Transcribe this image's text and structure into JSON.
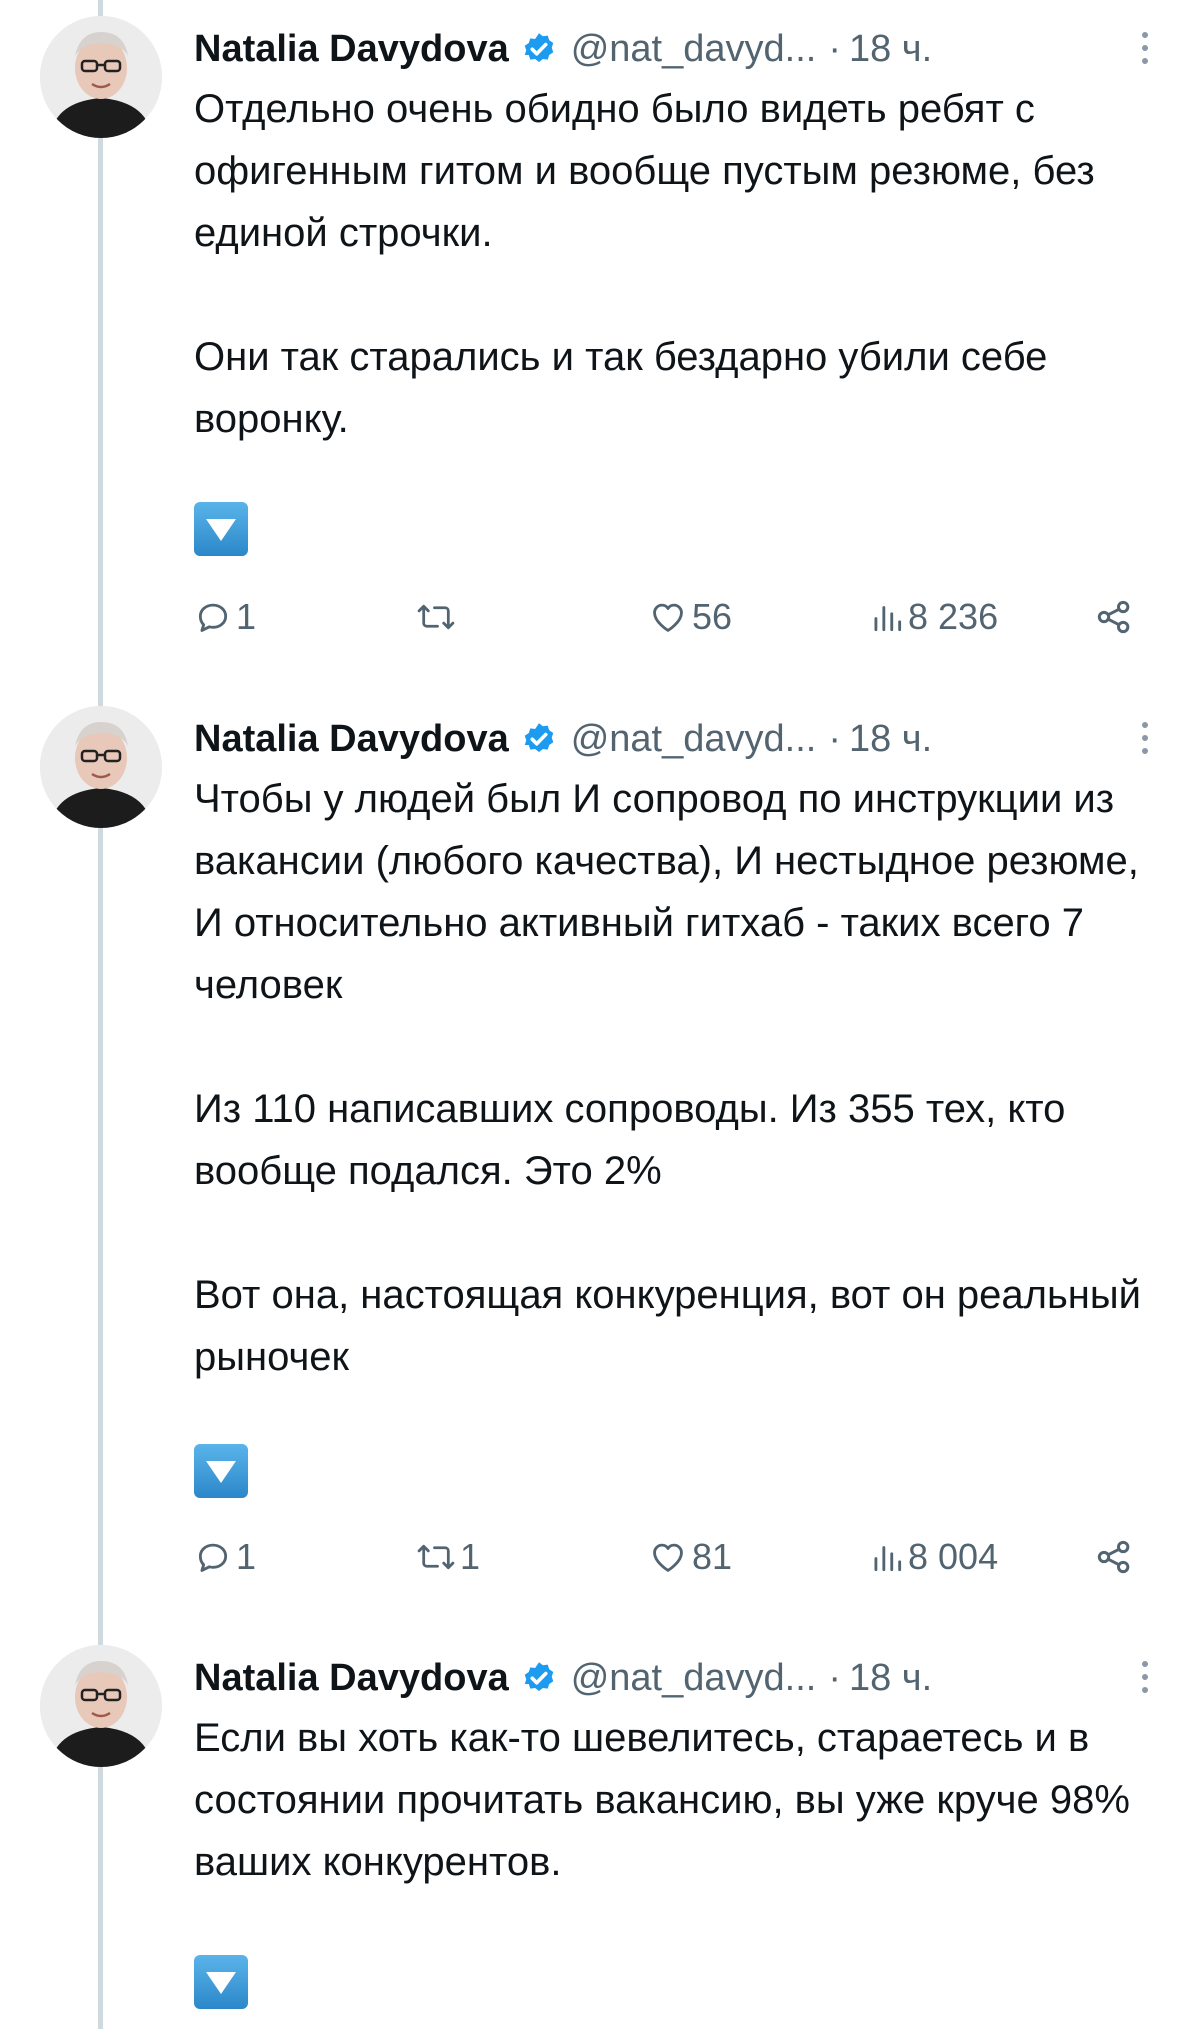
{
  "colors": {
    "thread_line": "#cfd9de",
    "verified_badge": "#1d9bf0",
    "secondary_text": "#536471",
    "emoji_bg": "#3f9bd8"
  },
  "tweets": [
    {
      "author": {
        "name": "Natalia Davydova",
        "handle": "@nat_davyd...",
        "verified": true
      },
      "separator": "·",
      "time": "18 ч.",
      "paragraphs": [
        "Отдельно очень обидно было видеть ребят с офигенным гитом и вообще пустым резюме, без единой строчки.",
        "Они так старались и так бездарно убили себе воронку."
      ],
      "emoji": "down-arrow-button",
      "actions": {
        "replies": "1",
        "reposts": "",
        "likes": "56",
        "views": "8 236"
      }
    },
    {
      "author": {
        "name": "Natalia Davydova",
        "handle": "@nat_davyd...",
        "verified": true
      },
      "separator": "·",
      "time": "18 ч.",
      "paragraphs": [
        "Чтобы у людей был И сопровод по инструкции из вакансии (любого качества), И нестыдное резюме, И относительно активный гитхаб - таких всего 7 человек",
        "Из 110 написавших сопроводы. Из 355 тех, кто вообще подался. Это 2%",
        "Вот она, настоящая конкуренция, вот он реальный рыночек"
      ],
      "emoji": "down-arrow-button",
      "actions": {
        "replies": "1",
        "reposts": "1",
        "likes": "81",
        "views": "8 004"
      }
    },
    {
      "author": {
        "name": "Natalia Davydova",
        "handle": "@nat_davyd...",
        "verified": true
      },
      "separator": "·",
      "time": "18 ч.",
      "paragraphs": [
        "Если вы хоть как-то шевелитесь, стараетесь и в состоянии прочитать вакансию, вы уже круче 98% ваших конкурентов."
      ],
      "emoji": "down-arrow-button"
    }
  ]
}
